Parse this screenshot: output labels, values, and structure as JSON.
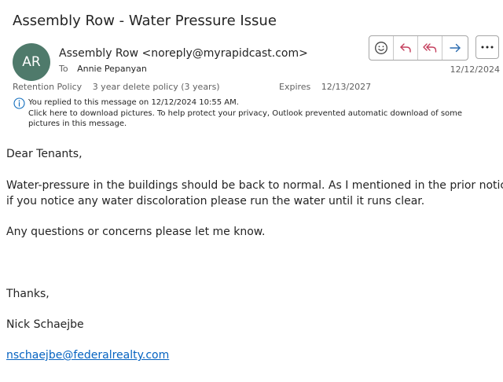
{
  "email": {
    "subject": "Assembly Row - Water Pressure Issue",
    "avatar_initials": "AR",
    "avatar_color": "#4f7a6b",
    "sender": "Assembly Row <noreply@myrapidcast.com>",
    "to_label": "To",
    "to_name": "Annie Pepanyan",
    "date": "12/12/2024",
    "retention_label": "Retention Policy",
    "retention_value": "3 year delete policy (3 years)",
    "expires_label": "Expires",
    "expires_value": "12/13/2027",
    "info_line1": "You replied to this message on 12/12/2024 10:55 AM.",
    "info_line2": "Click here to download pictures. To help protect your privacy, Outlook prevented automatic download of some",
    "info_line3": "pictures in this message."
  },
  "toolbar": {
    "buttons": [
      {
        "icon": "emoji-icon"
      },
      {
        "icon": "reply-icon"
      },
      {
        "icon": "reply-all-icon"
      },
      {
        "icon": "forward-icon"
      }
    ],
    "more_icon": "more-icon",
    "accent": "#c43e5c",
    "forward_color": "#2b6cb0"
  },
  "body": {
    "greeting": "Dear Tenants,",
    "para1_line1": "Water-pressure in the buildings should be back to normal.  As I mentioned in the prior notice,",
    "para1_line2": "if you notice any water discoloration please run the water until it runs clear.",
    "para2": "Any questions or concerns please let me know.",
    "thanks": "Thanks,",
    "signature_name": "Nick Schaejbe",
    "signature_email": "nschaejbe@federalrealty.com"
  }
}
